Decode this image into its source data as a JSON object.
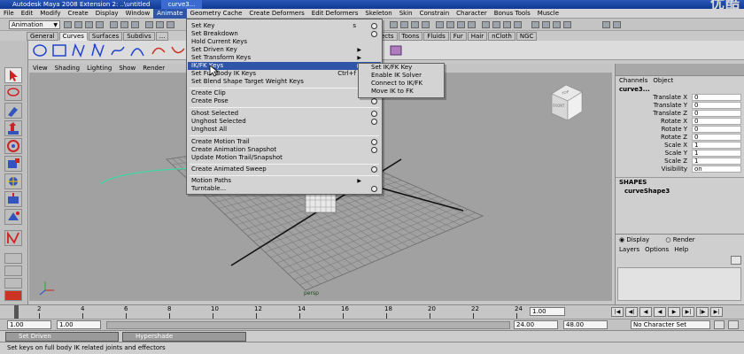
{
  "title_bar": {
    "app_title": "Autodesk Maya 2008 Extension 2: ..\\untitled",
    "tab_title": "curve3...",
    "watermark": "优酷"
  },
  "main_menu": [
    "File",
    "Edit",
    "Modify",
    "Create",
    "Display",
    "Window",
    "Animate",
    "Geometry Cache",
    "Create Deformers",
    "Edit Deformers",
    "Skeleton",
    "Skin",
    "Constrain",
    "Character",
    "Bonus Tools",
    "Muscle"
  ],
  "status_line": {
    "mode_selector": "Animation"
  },
  "shelf_tabs": [
    "General",
    "Curves",
    "Surfaces",
    "Subdivs",
    "...",
    "ects",
    "Toons",
    "Fluids",
    "Fur",
    "Hair",
    "nCloth",
    "NGC"
  ],
  "view_menu": [
    "View",
    "Shading",
    "Lighting",
    "Show",
    "Render"
  ],
  "viewport": {
    "camera_label": "persp",
    "viewcube_top": "TOP",
    "viewcube_front": "FRONT"
  },
  "animate_menu": {
    "items": [
      {
        "label": "Set Key",
        "shortcut": "s",
        "option": true
      },
      {
        "label": "Set Breakdown",
        "option": true
      },
      {
        "label": "Hold Current Keys"
      },
      {
        "label": "Set Driven Key",
        "submenu": true
      },
      {
        "label": "Set Transform Keys",
        "submenu": true
      },
      {
        "label": "IK/FK Keys",
        "submenu": true,
        "highlighted": true
      },
      {
        "label": "Set Full Body IK Keys",
        "shortcut": "Ctrl+f",
        "option": true
      },
      {
        "label": "Set Blend Shape Target Weight Keys"
      },
      {
        "label": "Create Clip",
        "option": true
      },
      {
        "label": "Create Pose",
        "option": true
      },
      {
        "label": "Ghost Selected",
        "option": true
      },
      {
        "label": "Unghost Selected",
        "option": true
      },
      {
        "label": "Unghost All"
      },
      {
        "label": "Create Motion Trail",
        "option": true
      },
      {
        "label": "Create Animation Snapshot",
        "option": true
      },
      {
        "label": "Update Motion Trail/Snapshot"
      },
      {
        "label": "Create Animated Sweep",
        "option": true
      },
      {
        "label": "Motion Paths",
        "submenu": true
      },
      {
        "label": "Turntable...",
        "option": true
      }
    ]
  },
  "ikfk_submenu": [
    "Set IK/FK Key",
    "Enable IK Solver",
    "Connect to IK/FK",
    "Move IK to FK"
  ],
  "channel_box": {
    "menus": [
      "Channels",
      "Object"
    ],
    "object_name": "curve3...",
    "attributes": [
      {
        "name": "Translate X",
        "value": "0"
      },
      {
        "name": "Translate Y",
        "value": "0"
      },
      {
        "name": "Translate Z",
        "value": "0"
      },
      {
        "name": "Rotate X",
        "value": "0"
      },
      {
        "name": "Rotate Y",
        "value": "0"
      },
      {
        "name": "Rotate Z",
        "value": "0"
      },
      {
        "name": "Scale X",
        "value": "1"
      },
      {
        "name": "Scale Y",
        "value": "1"
      },
      {
        "name": "Scale Z",
        "value": "1"
      },
      {
        "name": "Visibility",
        "value": "on"
      }
    ],
    "shapes_header": "SHAPES",
    "shape_name": "curveShape3",
    "layer_modes": [
      "Display",
      "Render"
    ],
    "layer_menus": [
      "Layers",
      "Options",
      "Help"
    ]
  },
  "time_slider": {
    "ticks": [
      "2",
      "4",
      "6",
      "8",
      "10",
      "12",
      "14",
      "16",
      "18",
      "20",
      "22",
      "24"
    ],
    "current_time": "1.00"
  },
  "range_slider": {
    "start_time": "1.00",
    "playback_start": "1.00",
    "playback_end": "24.00",
    "end_time": "48.00",
    "character_set": "No Character Set"
  },
  "taskbar": {
    "items": [
      "Set Driven",
      "Hypershade"
    ]
  },
  "help_line": "Set keys on full body IK related joints and effectors",
  "colors": {
    "accent": "#2e55a8",
    "viewport": "#a1a1a1",
    "menu_bg": "#d3d3d3"
  }
}
